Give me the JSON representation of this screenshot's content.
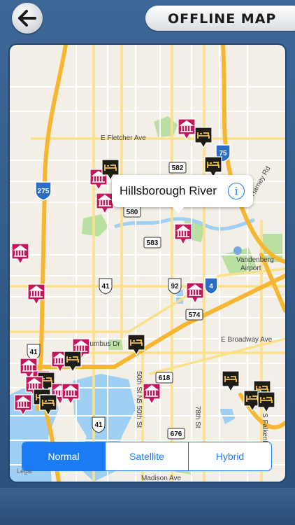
{
  "header": {
    "title": "OFFLINE MAP",
    "back_icon": "arrow-left-icon"
  },
  "map": {
    "callout": {
      "title": "Hillsborough River",
      "info_icon": "info-icon"
    },
    "labels": {
      "fletcher": "E Fletcher Ave",
      "harney": "Harney Rd",
      "airport": "Vandenberg\nAirport",
      "broadway": "E Broadway Ave",
      "columbus": "E Columbus Dr",
      "fiftieth": "S 50th St",
      "fiftieth_n": "50th St N",
      "seventyeighth": "78th St",
      "falkenburg": "S Falkenb",
      "madison": "Madison Ave"
    },
    "shields": {
      "i275": "275",
      "i75": "75",
      "i4": "4",
      "us41a": "41",
      "us41b": "41",
      "us41c": "41",
      "us92": "92",
      "s580": "580",
      "s582": "582",
      "s583": "583",
      "s574": "574",
      "s618": "618",
      "s676": "676"
    },
    "pin_types": {
      "museum": "museum-icon",
      "hotel": "hotel-icon"
    },
    "colors": {
      "museum": "#c2185b",
      "hotel": "#1d1d16",
      "water": "#9fcff2",
      "park": "#b9dfa3",
      "highway": "#f7c34c",
      "accent": "#1a7cf5"
    }
  },
  "map_type": {
    "options": [
      "Normal",
      "Satellite",
      "Hybrid"
    ],
    "selected": "Normal"
  },
  "legal": "Legal"
}
